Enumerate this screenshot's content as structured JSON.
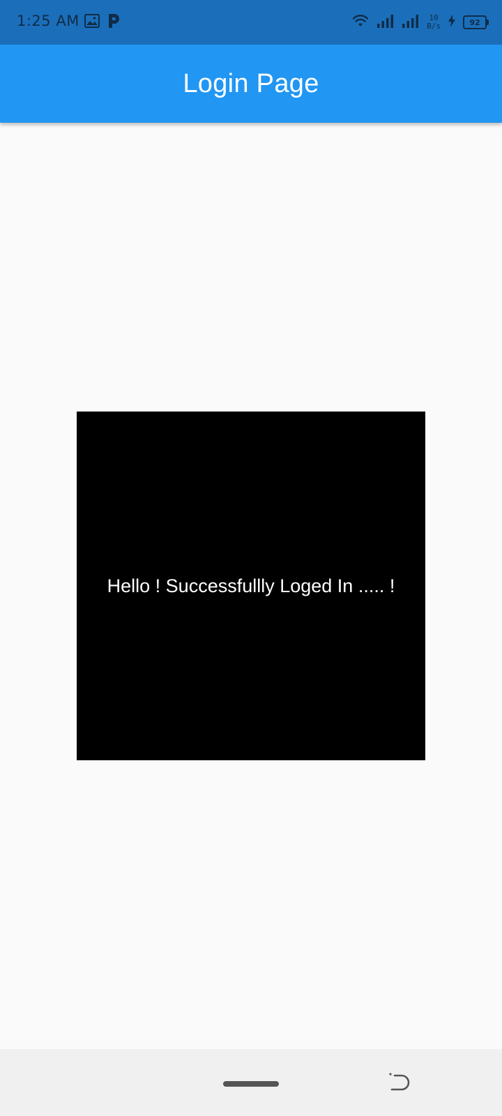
{
  "status_bar": {
    "time": "1:25 AM",
    "left_icons": [
      "image-icon",
      "parking-icon"
    ],
    "net_speed_value": "10",
    "net_speed_unit": "B/s",
    "battery_level": "92",
    "background_color": "#1b6fba"
  },
  "app_bar": {
    "title": "Login Page",
    "background_color": "#2196f3"
  },
  "main": {
    "message": "Hello ! Successfullly Loged In ..... !",
    "box_color": "#000000",
    "background_color": "#fafafa"
  },
  "nav_bar": {
    "icons": [
      "home-pill-icon",
      "back-gesture-icon"
    ]
  }
}
